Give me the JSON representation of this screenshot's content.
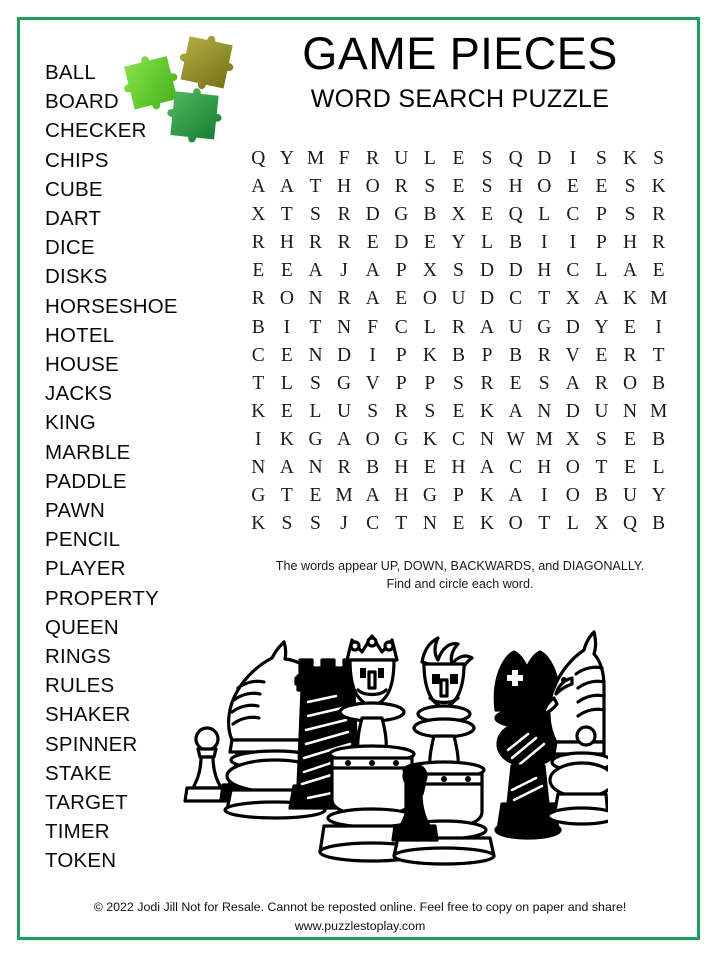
{
  "page": {
    "border_color": "#1fa05a",
    "background": "#ffffff"
  },
  "header": {
    "title": "GAME PIECES",
    "subtitle": "WORD SEARCH PUZZLE"
  },
  "decoration": {
    "puzzle_pieces": [
      {
        "name": "puzzle-piece-bright-green",
        "color": "#62d82a",
        "color2": "#8ce84f"
      },
      {
        "name": "puzzle-piece-olive",
        "color": "#8b8b1e",
        "color2": "#b5b045"
      },
      {
        "name": "puzzle-piece-green",
        "color": "#1f8a3c",
        "color2": "#4cb85f"
      }
    ],
    "chess_set_alt": "chess-pieces-line-art"
  },
  "word_list": {
    "words": [
      "BALL",
      "BOARD",
      "CHECKER",
      "CHIPS",
      "CUBE",
      "DART",
      "DICE",
      "DISKS",
      "HORSESHOE",
      "HOTEL",
      "HOUSE",
      "JACKS",
      "KING",
      "MARBLE",
      "PADDLE",
      "PAWN",
      "PENCIL",
      "PLAYER",
      "PROPERTY",
      "QUEEN",
      "RINGS",
      "RULES",
      "SHAKER",
      "SPINNER",
      "STAKE",
      "TARGET",
      "TIMER",
      "TOKEN"
    ]
  },
  "grid": {
    "rows": 14,
    "cols": 15,
    "letters": [
      [
        "Q",
        "Y",
        "M",
        "F",
        "R",
        "U",
        "L",
        "E",
        "S",
        "Q",
        "D",
        "I",
        "S",
        "K",
        "S"
      ],
      [
        "A",
        "A",
        "T",
        "H",
        "O",
        "R",
        "S",
        "E",
        "S",
        "H",
        "O",
        "E",
        "E",
        "S",
        "K"
      ],
      [
        "X",
        "T",
        "S",
        "R",
        "D",
        "G",
        "B",
        "X",
        "E",
        "Q",
        "L",
        "C",
        "P",
        "S",
        "R"
      ],
      [
        "R",
        "H",
        "R",
        "R",
        "E",
        "D",
        "E",
        "Y",
        "L",
        "B",
        "I",
        "I",
        "P",
        "H",
        "R"
      ],
      [
        "E",
        "E",
        "A",
        "J",
        "A",
        "P",
        "X",
        "S",
        "D",
        "D",
        "H",
        "C",
        "L",
        "A",
        "E"
      ],
      [
        "R",
        "O",
        "N",
        "R",
        "A",
        "E",
        "O",
        "U",
        "D",
        "C",
        "T",
        "X",
        "A",
        "K",
        "M"
      ],
      [
        "B",
        "I",
        "T",
        "N",
        "F",
        "C",
        "L",
        "R",
        "A",
        "U",
        "G",
        "D",
        "Y",
        "E",
        "I"
      ],
      [
        "C",
        "E",
        "N",
        "D",
        "I",
        "P",
        "K",
        "B",
        "P",
        "B",
        "R",
        "V",
        "E",
        "R",
        "T"
      ],
      [
        "T",
        "L",
        "S",
        "G",
        "V",
        "P",
        "P",
        "S",
        "R",
        "E",
        "S",
        "A",
        "R",
        "O",
        "B"
      ],
      [
        "K",
        "E",
        "L",
        "U",
        "S",
        "R",
        "S",
        "E",
        "K",
        "A",
        "N",
        "D",
        "U",
        "N",
        "M"
      ],
      [
        "I",
        "K",
        "G",
        "A",
        "O",
        "G",
        "K",
        "C",
        "N",
        "W",
        "M",
        "X",
        "S",
        "E",
        "B"
      ],
      [
        "N",
        "A",
        "N",
        "R",
        "B",
        "H",
        "E",
        "H",
        "A",
        "C",
        "H",
        "O",
        "T",
        "E",
        "L"
      ],
      [
        "G",
        "T",
        "E",
        "M",
        "A",
        "H",
        "G",
        "P",
        "K",
        "A",
        "I",
        "O",
        "B",
        "U",
        "Y"
      ],
      [
        "K",
        "S",
        "S",
        "J",
        "C",
        "T",
        "N",
        "E",
        "K",
        "O",
        "T",
        "L",
        "X",
        "Q",
        "B"
      ]
    ]
  },
  "instructions": {
    "line1": "The words appear UP, DOWN, BACKWARDS, and DIAGONALLY.",
    "line2": "Find and circle each word."
  },
  "footer": {
    "line1": "© 2022  Jodi Jill Not for Resale. Cannot be reposted online. Feel free to copy on paper and share!",
    "line2": "www.puzzlestoplay.com"
  }
}
